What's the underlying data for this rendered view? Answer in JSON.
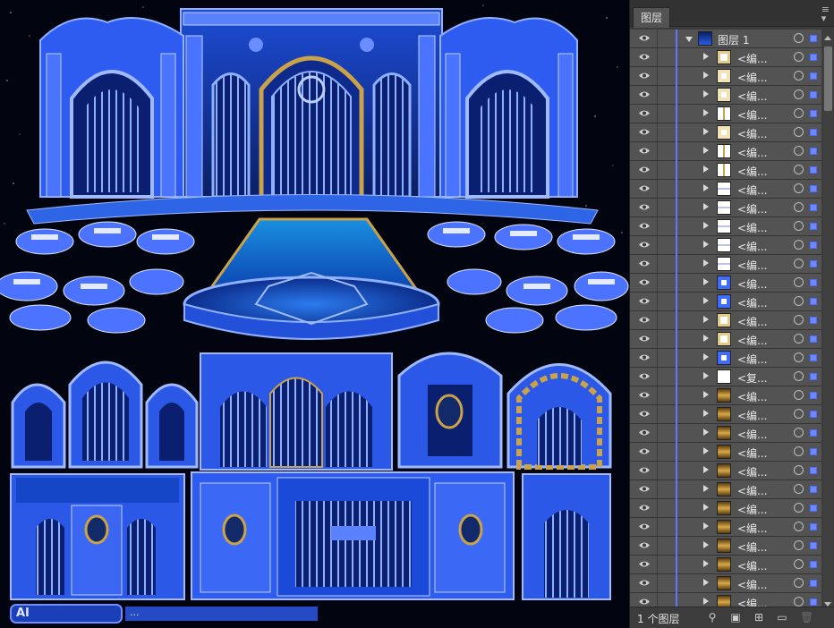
{
  "panel": {
    "tab_label": "图层",
    "menu_icon": "panel-menu-icon",
    "footer_count": "1 个图层",
    "accent_color": "#5b78ff"
  },
  "layers": [
    {
      "name": "图层 1",
      "expanded": true,
      "thumb": "scene"
    },
    {
      "name": "<编...",
      "thumb": "arch"
    },
    {
      "name": "<编...",
      "thumb": "ornament"
    },
    {
      "name": "<编...",
      "thumb": "ornament"
    },
    {
      "name": "<编...",
      "thumb": "lamp"
    },
    {
      "name": "<编...",
      "thumb": "ornament"
    },
    {
      "name": "<编...",
      "thumb": "lamp"
    },
    {
      "name": "<编...",
      "thumb": "lamp"
    },
    {
      "name": "<编...",
      "thumb": "panel"
    },
    {
      "name": "<编...",
      "thumb": "panel"
    },
    {
      "name": "<编...",
      "thumb": "panel"
    },
    {
      "name": "<编...",
      "thumb": "panel"
    },
    {
      "name": "<编...",
      "thumb": "panel"
    },
    {
      "name": "<编...",
      "thumb": "blue"
    },
    {
      "name": "<编...",
      "thumb": "blue"
    },
    {
      "name": "<编...",
      "thumb": "arch"
    },
    {
      "name": "<编...",
      "thumb": "arch"
    },
    {
      "name": "<编...",
      "thumb": "blue"
    },
    {
      "name": "<复...",
      "thumb": "white"
    },
    {
      "name": "<编...",
      "thumb": "gold"
    },
    {
      "name": "<编...",
      "thumb": "gold"
    },
    {
      "name": "<编...",
      "thumb": "gold"
    },
    {
      "name": "<编...",
      "thumb": "gold"
    },
    {
      "name": "<编...",
      "thumb": "gold"
    },
    {
      "name": "<编...",
      "thumb": "gold"
    },
    {
      "name": "<编...",
      "thumb": "gold"
    },
    {
      "name": "<编...",
      "thumb": "gold"
    },
    {
      "name": "<编...",
      "thumb": "gold"
    },
    {
      "name": "<编...",
      "thumb": "gold"
    },
    {
      "name": "<编...",
      "thumb": "gold"
    },
    {
      "name": "<编...",
      "thumb": "gold"
    }
  ],
  "canvas": {
    "watermark_left": "AI",
    "watermark_right": "...",
    "colors": {
      "bg": "#020410",
      "blue": "#3f6bff",
      "light": "#8fb0ff",
      "gold": "#c9a24a",
      "dark": "#0c2a8a"
    }
  }
}
